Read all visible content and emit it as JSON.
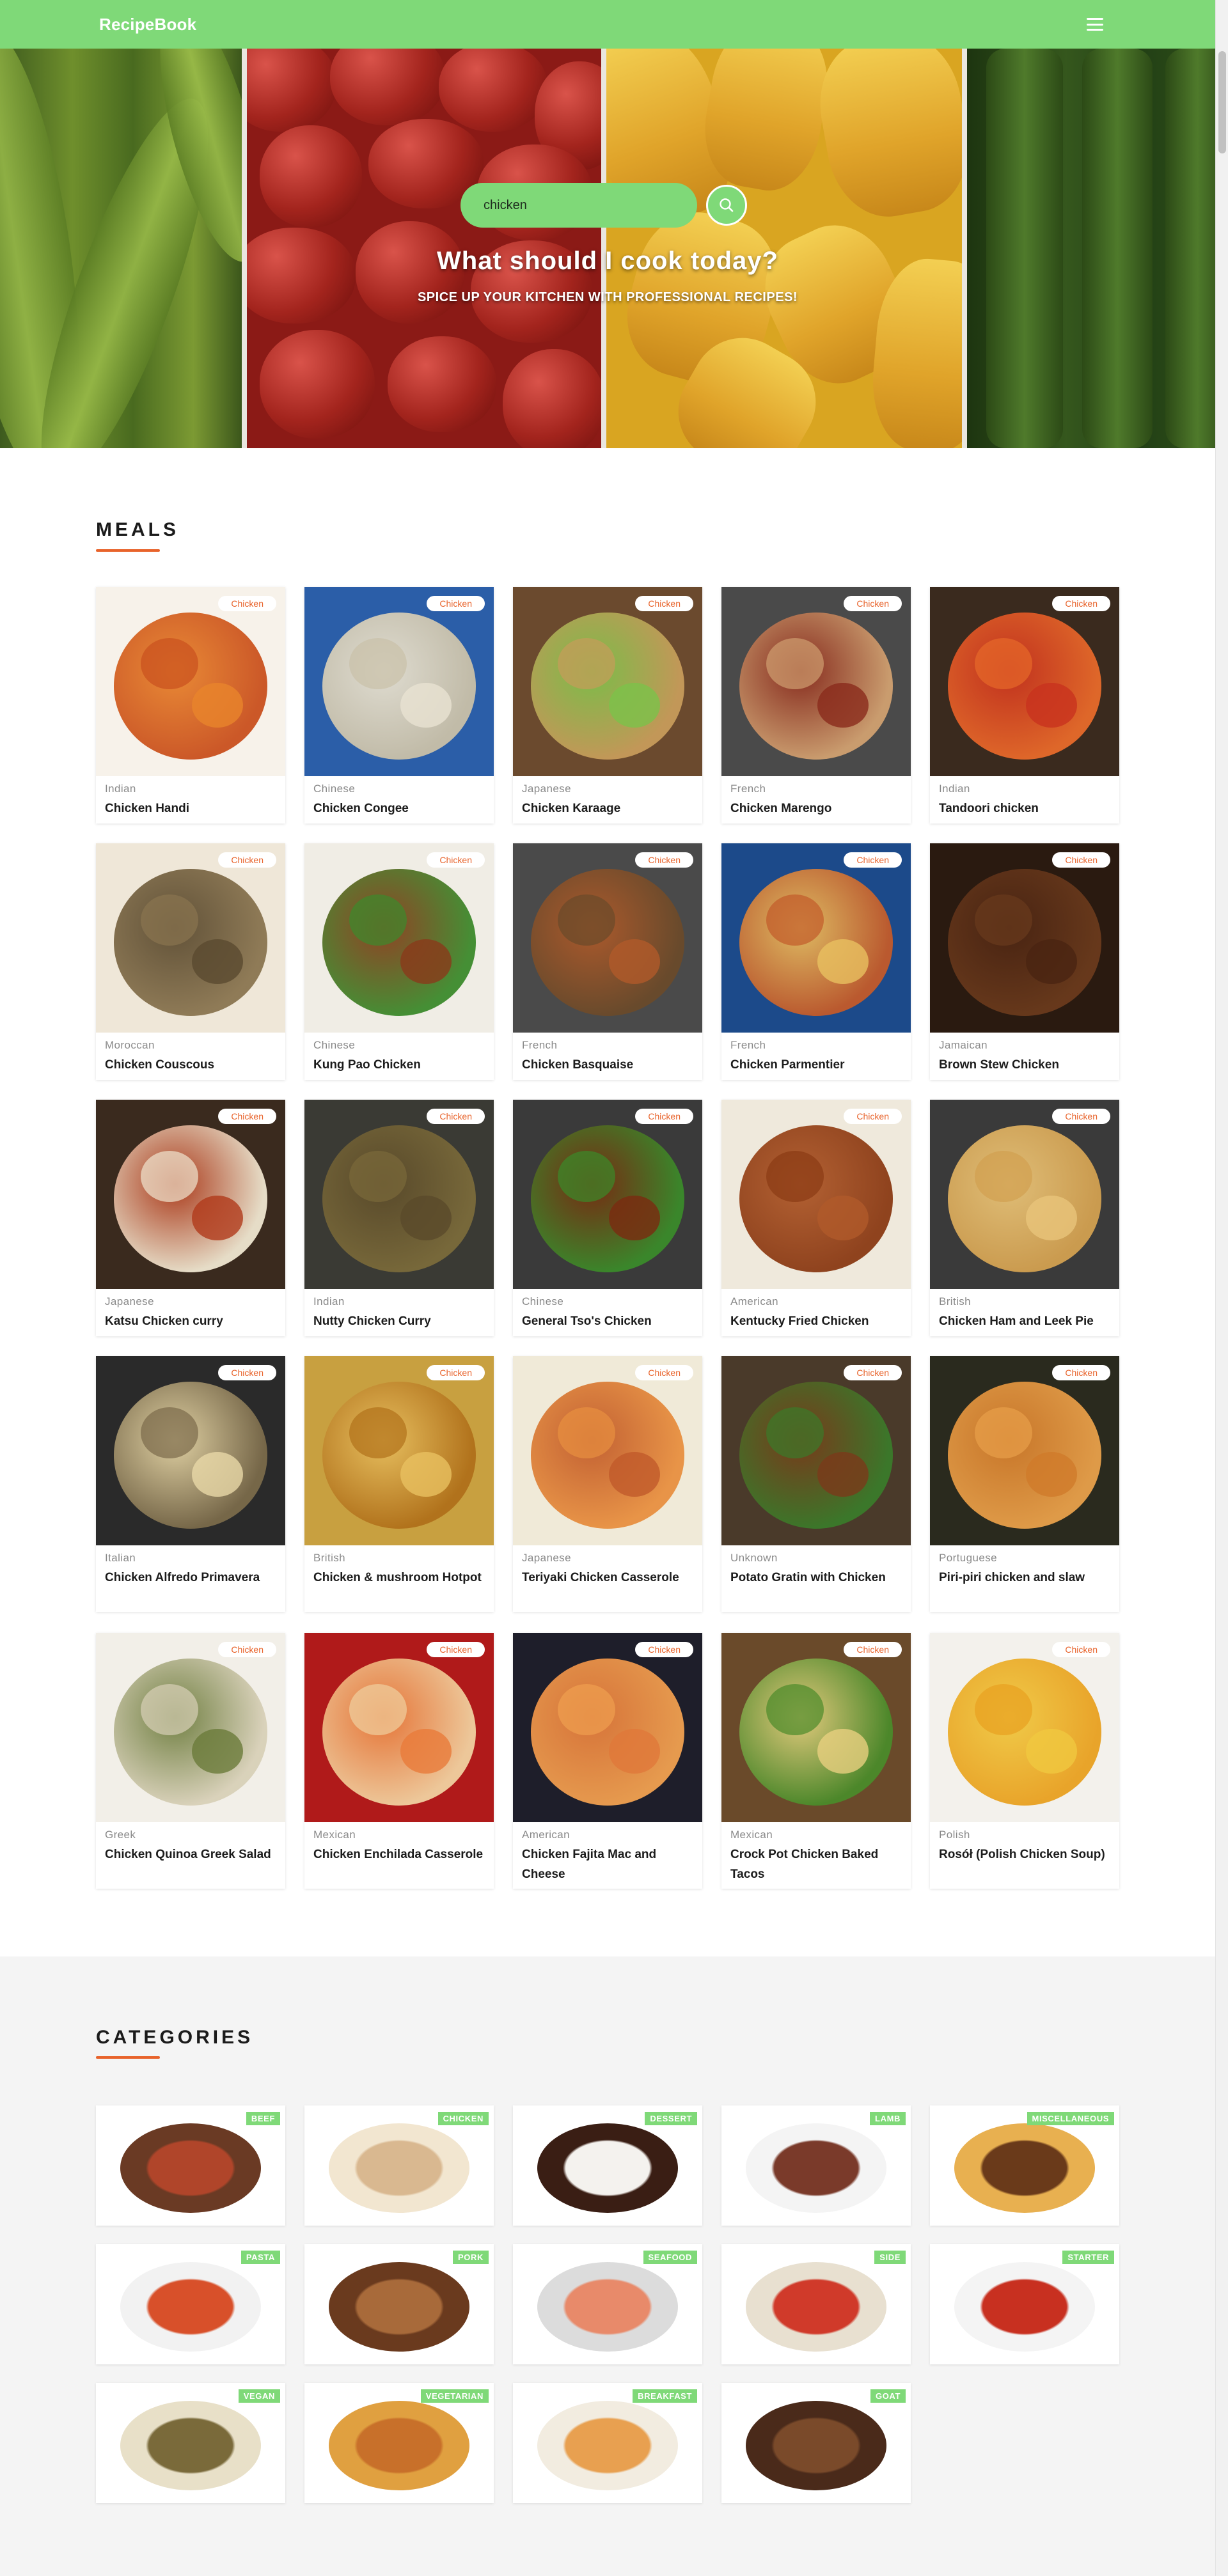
{
  "navbar": {
    "brand": "RecipeBook",
    "menu_icon": "hamburger-menu-icon"
  },
  "hero": {
    "search_value": "chicken",
    "search_icon": "search-icon",
    "title": "What should I cook today?",
    "subtitle": "SPICE UP YOUR KITCHEN WITH PROFESSIONAL RECIPES!"
  },
  "meals": {
    "heading": "MEALS",
    "items": [
      {
        "tag": "Chicken",
        "origin": "Indian",
        "name": "Chicken Handi"
      },
      {
        "tag": "Chicken",
        "origin": "Chinese",
        "name": "Chicken Congee"
      },
      {
        "tag": "Chicken",
        "origin": "Japanese",
        "name": "Chicken Karaage"
      },
      {
        "tag": "Chicken",
        "origin": "French",
        "name": "Chicken Marengo"
      },
      {
        "tag": "Chicken",
        "origin": "Indian",
        "name": "Tandoori chicken"
      },
      {
        "tag": "Chicken",
        "origin": "Moroccan",
        "name": "Chicken Couscous"
      },
      {
        "tag": "Chicken",
        "origin": "Chinese",
        "name": "Kung Pao Chicken"
      },
      {
        "tag": "Chicken",
        "origin": "French",
        "name": "Chicken Basquaise"
      },
      {
        "tag": "Chicken",
        "origin": "French",
        "name": "Chicken Parmentier"
      },
      {
        "tag": "Chicken",
        "origin": "Jamaican",
        "name": "Brown Stew Chicken"
      },
      {
        "tag": "Chicken",
        "origin": "Japanese",
        "name": "Katsu Chicken curry"
      },
      {
        "tag": "Chicken",
        "origin": "Indian",
        "name": "Nutty Chicken Curry"
      },
      {
        "tag": "Chicken",
        "origin": "Chinese",
        "name": "General Tso's Chicken"
      },
      {
        "tag": "Chicken",
        "origin": "American",
        "name": "Kentucky Fried Chicken"
      },
      {
        "tag": "Chicken",
        "origin": "British",
        "name": "Chicken Ham and Leek Pie"
      },
      {
        "tag": "Chicken",
        "origin": "Italian",
        "name": "Chicken Alfredo Primavera"
      },
      {
        "tag": "Chicken",
        "origin": "British",
        "name": "Chicken & mushroom Hotpot"
      },
      {
        "tag": "Chicken",
        "origin": "Japanese",
        "name": "Teriyaki Chicken Casserole"
      },
      {
        "tag": "Chicken",
        "origin": "Unknown",
        "name": "Potato Gratin with Chicken"
      },
      {
        "tag": "Chicken",
        "origin": "Portuguese",
        "name": "Piri-piri chicken and slaw"
      },
      {
        "tag": "Chicken",
        "origin": "Greek",
        "name": "Chicken Quinoa Greek Salad"
      },
      {
        "tag": "Chicken",
        "origin": "Mexican",
        "name": "Chicken Enchilada Casserole"
      },
      {
        "tag": "Chicken",
        "origin": "American",
        "name": "Chicken Fajita Mac and Cheese"
      },
      {
        "tag": "Chicken",
        "origin": "Mexican",
        "name": "Crock Pot Chicken Baked Tacos"
      },
      {
        "tag": "Chicken",
        "origin": "Polish",
        "name": "Rosół (Polish Chicken Soup)"
      }
    ]
  },
  "categories": {
    "heading": "CATEGORIES",
    "items": [
      {
        "label": "BEEF"
      },
      {
        "label": "CHICKEN"
      },
      {
        "label": "DESSERT"
      },
      {
        "label": "LAMB"
      },
      {
        "label": "MISCELLANEOUS"
      },
      {
        "label": "PASTA"
      },
      {
        "label": "PORK"
      },
      {
        "label": "SEAFOOD"
      },
      {
        "label": "SIDE"
      },
      {
        "label": "STARTER"
      },
      {
        "label": "VEGAN"
      },
      {
        "label": "VEGETARIAN"
      },
      {
        "label": "BREAKFAST"
      },
      {
        "label": "GOAT"
      }
    ]
  },
  "colors": {
    "brand_green": "#7fd978",
    "accent_orange": "#e8632b",
    "muted_text": "#8a8a8a"
  }
}
